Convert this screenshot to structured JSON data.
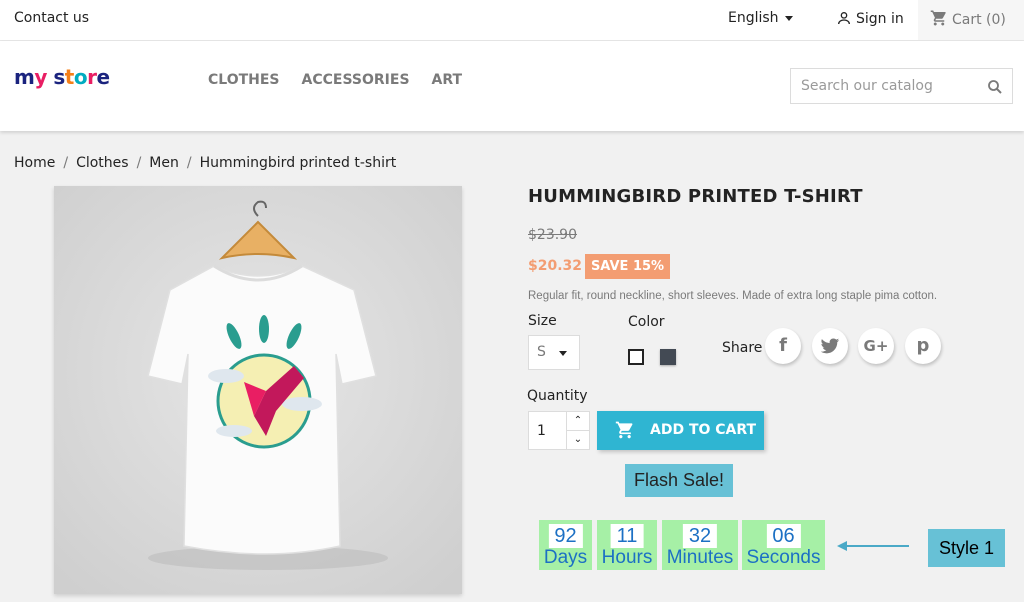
{
  "topbar": {
    "contact": "Contact us",
    "language": "English",
    "signin": "Sign in",
    "cart": "Cart (0)"
  },
  "header": {
    "logo": [
      "m",
      "y",
      " ",
      "s",
      "t",
      "o",
      "r",
      "e"
    ],
    "nav": [
      "CLOTHES",
      "ACCESSORIES",
      "ART"
    ],
    "search_placeholder": "Search our catalog"
  },
  "breadcrumb": [
    "Home",
    "Clothes",
    "Men",
    "Hummingbird printed t-shirt"
  ],
  "product": {
    "title": "HUMMINGBIRD PRINTED T-SHIRT",
    "old_price": "$23.90",
    "price": "$20.32",
    "save": "SAVE 15%",
    "description": "Regular fit, round neckline, short sleeves. Made of extra long staple pima cotton.",
    "size_label": "Size",
    "size_value": "S",
    "color_label": "Color",
    "colors": [
      "#ffffff",
      "#434a54"
    ],
    "share_label": "Share",
    "social": [
      "f",
      "t",
      "G+",
      "p"
    ],
    "quantity_label": "Quantity",
    "quantity": "1",
    "add_to_cart": "ADD TO CART"
  },
  "promo": {
    "flash": "Flash Sale!",
    "countdown": [
      {
        "num": "92",
        "unit": "Days"
      },
      {
        "num": "11",
        "unit": "Hours"
      },
      {
        "num": "32",
        "unit": "Minutes"
      },
      {
        "num": "06",
        "unit": "Seconds"
      }
    ],
    "style_label": "Style 1",
    "accent": "#2fb5d2",
    "countdown_bg": "#a6f0a6"
  }
}
